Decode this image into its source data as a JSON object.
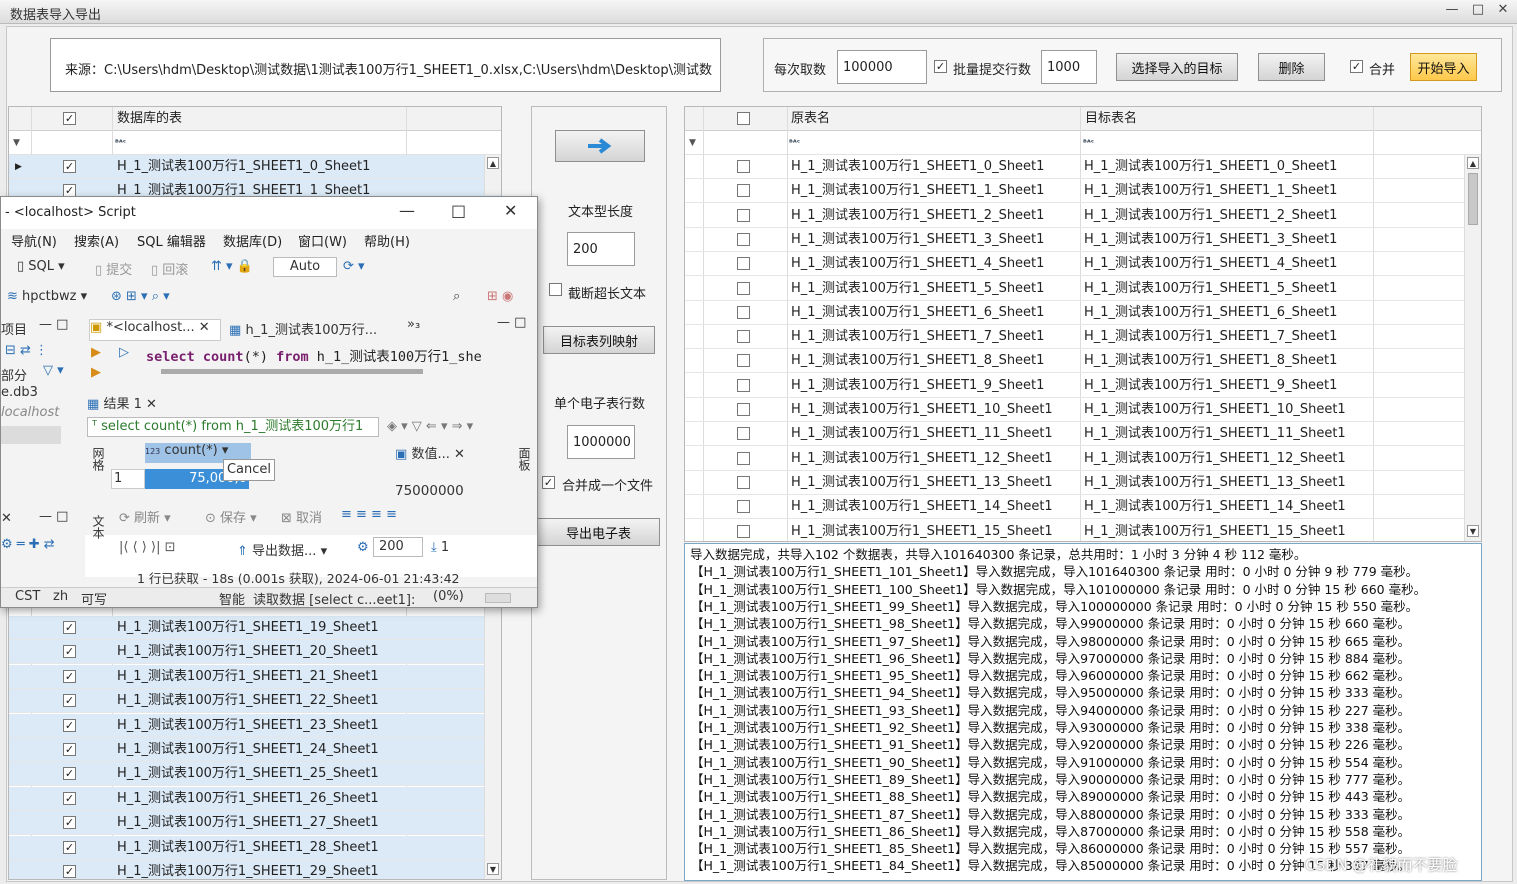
{
  "window": {
    "title": "数据表导入导出",
    "min": "—",
    "max": "□",
    "close": "✕"
  },
  "source": {
    "text": "来源：C:\\Users\\hdm\\Desktop\\测试数据\\1测试表100万行1_SHEET1_0.xlsx,C:\\Users\\hdm\\Desktop\\测试数"
  },
  "options": {
    "fetch_label": "每次取数",
    "fetch_value": "100000",
    "batch_label": "批量提交行数",
    "batch_value": "1000",
    "select_target": "选择导入的目标",
    "delete": "删除",
    "merge_label": "合并",
    "start": "开始导入"
  },
  "left_grid": {
    "header": "数据库的表",
    "filter_icon": "ᴮᴬᶜ",
    "rows_top": [
      "H_1_测试表100万行1_SHEET1_0_Sheet1",
      "H_1_测试表100万行1_SHEET1_1_Sheet1"
    ],
    "rows_bottom": [
      "H_1_测试表100万行1_SHEET1_19_Sheet1",
      "H_1_测试表100万行1_SHEET1_20_Sheet1",
      "H_1_测试表100万行1_SHEET1_21_Sheet1",
      "H_1_测试表100万行1_SHEET1_22_Sheet1",
      "H_1_测试表100万行1_SHEET1_23_Sheet1",
      "H_1_测试表100万行1_SHEET1_24_Sheet1",
      "H_1_测试表100万行1_SHEET1_25_Sheet1",
      "H_1_测试表100万行1_SHEET1_26_Sheet1",
      "H_1_测试表100万行1_SHEET1_27_Sheet1",
      "H_1_测试表100万行1_SHEET1_28_Sheet1",
      "H_1_测试表100万行1_SHEET1_29_Sheet1"
    ]
  },
  "mid": {
    "text_len_label": "文本型长度",
    "text_len_value": "200",
    "truncate_label": "截断超长文本",
    "map_button": "目标表列映射",
    "rows_label": "单个电子表行数",
    "rows_value": "1000000",
    "merge_file_label": "合并成一个文件",
    "export_button": "导出电子表"
  },
  "right_grid": {
    "col1": "原表名",
    "col2": "目标表名",
    "rows": [
      [
        "H_1_测试表100万行1_SHEET1_0_Sheet1",
        "H_1_测试表100万行1_SHEET1_0_Sheet1"
      ],
      [
        "H_1_测试表100万行1_SHEET1_1_Sheet1",
        "H_1_测试表100万行1_SHEET1_1_Sheet1"
      ],
      [
        "H_1_测试表100万行1_SHEET1_2_Sheet1",
        "H_1_测试表100万行1_SHEET1_2_Sheet1"
      ],
      [
        "H_1_测试表100万行1_SHEET1_3_Sheet1",
        "H_1_测试表100万行1_SHEET1_3_Sheet1"
      ],
      [
        "H_1_测试表100万行1_SHEET1_4_Sheet1",
        "H_1_测试表100万行1_SHEET1_4_Sheet1"
      ],
      [
        "H_1_测试表100万行1_SHEET1_5_Sheet1",
        "H_1_测试表100万行1_SHEET1_5_Sheet1"
      ],
      [
        "H_1_测试表100万行1_SHEET1_6_Sheet1",
        "H_1_测试表100万行1_SHEET1_6_Sheet1"
      ],
      [
        "H_1_测试表100万行1_SHEET1_7_Sheet1",
        "H_1_测试表100万行1_SHEET1_7_Sheet1"
      ],
      [
        "H_1_测试表100万行1_SHEET1_8_Sheet1",
        "H_1_测试表100万行1_SHEET1_8_Sheet1"
      ],
      [
        "H_1_测试表100万行1_SHEET1_9_Sheet1",
        "H_1_测试表100万行1_SHEET1_9_Sheet1"
      ],
      [
        "H_1_测试表100万行1_SHEET1_10_Sheet1",
        "H_1_测试表100万行1_SHEET1_10_Sheet1"
      ],
      [
        "H_1_测试表100万行1_SHEET1_11_Sheet1",
        "H_1_测试表100万行1_SHEET1_11_Sheet1"
      ],
      [
        "H_1_测试表100万行1_SHEET1_12_Sheet1",
        "H_1_测试表100万行1_SHEET1_12_Sheet1"
      ],
      [
        "H_1_测试表100万行1_SHEET1_13_Sheet1",
        "H_1_测试表100万行1_SHEET1_13_Sheet1"
      ],
      [
        "H_1_测试表100万行1_SHEET1_14_Sheet1",
        "H_1_测试表100万行1_SHEET1_14_Sheet1"
      ],
      [
        "H_1_测试表100万行1_SHEET1_15_Sheet1",
        "H_1_测试表100万行1_SHEET1_15_Sheet1"
      ]
    ]
  },
  "log": [
    "导入数据完成，共导入102 个数据表，共导入101640300 条记录，总共用时：1 小时 3 分钟 4 秒 112 毫秒。",
    "【H_1_测试表100万行1_SHEET1_101_Sheet1】导入数据完成，导入101640300 条记录 用时：0 小时 0 分钟 9 秒 779 毫秒。",
    "【H_1_测试表100万行1_SHEET1_100_Sheet1】导入数据完成，导入101000000 条记录 用时：0 小时 0 分钟 15 秒 660 毫秒。",
    "【H_1_测试表100万行1_SHEET1_99_Sheet1】导入数据完成，导入100000000 条记录 用时：0 小时 0 分钟 15 秒 550 毫秒。",
    "【H_1_测试表100万行1_SHEET1_98_Sheet1】导入数据完成，导入99000000 条记录 用时：0 小时 0 分钟 15 秒 660 毫秒。",
    "【H_1_测试表100万行1_SHEET1_97_Sheet1】导入数据完成，导入98000000 条记录 用时：0 小时 0 分钟 15 秒 665 毫秒。",
    "【H_1_测试表100万行1_SHEET1_96_Sheet1】导入数据完成，导入97000000 条记录 用时：0 小时 0 分钟 15 秒 884 毫秒。",
    "【H_1_测试表100万行1_SHEET1_95_Sheet1】导入数据完成，导入96000000 条记录 用时：0 小时 0 分钟 15 秒 662 毫秒。",
    "【H_1_测试表100万行1_SHEET1_94_Sheet1】导入数据完成，导入95000000 条记录 用时：0 小时 0 分钟 15 秒 333 毫秒。",
    "【H_1_测试表100万行1_SHEET1_93_Sheet1】导入数据完成，导入94000000 条记录 用时：0 小时 0 分钟 15 秒 227 毫秒。",
    "【H_1_测试表100万行1_SHEET1_92_Sheet1】导入数据完成，导入93000000 条记录 用时：0 小时 0 分钟 15 秒 338 毫秒。",
    "【H_1_测试表100万行1_SHEET1_91_Sheet1】导入数据完成，导入92000000 条记录 用时：0 小时 0 分钟 15 秒 226 毫秒。",
    "【H_1_测试表100万行1_SHEET1_90_Sheet1】导入数据完成，导入91000000 条记录 用时：0 小时 0 分钟 15 秒 554 毫秒。",
    "【H_1_测试表100万行1_SHEET1_89_Sheet1】导入数据完成，导入90000000 条记录 用时：0 小时 0 分钟 15 秒 777 毫秒。",
    "【H_1_测试表100万行1_SHEET1_88_Sheet1】导入数据完成，导入89000000 条记录 用时：0 小时 0 分钟 15 秒 443 毫秒。",
    "【H_1_测试表100万行1_SHEET1_87_Sheet1】导入数据完成，导入88000000 条记录 用时：0 小时 0 分钟 15 秒 333 毫秒。",
    "【H_1_测试表100万行1_SHEET1_86_Sheet1】导入数据完成，导入87000000 条记录 用时：0 小时 0 分钟 15 秒 558 毫秒。",
    "【H_1_测试表100万行1_SHEET1_85_Sheet1】导入数据完成，导入86000000 条记录 用时：0 小时 0 分钟 15 秒 557 毫秒。",
    "【H_1_测试表100万行1_SHEET1_84_Sheet1】导入数据完成，导入85000000 条记录 用时：0 小时 0 分钟 15 秒 337 毫秒。"
  ],
  "watermark": "CSDN @礼貌而不要脸",
  "dbeaver": {
    "title": "- <localhost> Script",
    "menu": [
      "导航(N)",
      "搜索(A)",
      "SQL 编辑器",
      "数据库(D)",
      "窗口(W)",
      "帮助(H)"
    ],
    "tb_sql": "SQL",
    "tb_commit": "提交",
    "tb_rollback": "回滚",
    "tb_auto": "Auto",
    "db": "hpctbwz",
    "left_tab": "项目",
    "left_db": "e.db3",
    "left_part": "部分",
    "left_local": "localhost",
    "tab1": "*<localhost...",
    "tab2": "h_1_测试表100万行...",
    "tab_more": "»₃",
    "sql": "h_1_测试表100万行1_she",
    "result_tab": "结果 1",
    "result_filter": "select count(*) from h_1_测试表100万行1",
    "col": "count(*)",
    "row_no": "1",
    "row_val": "75,000,0",
    "cancel": "Cancel",
    "value_panel": "数值...",
    "value": "75000000",
    "refresh": "刷新",
    "save": "保存",
    "cancel_btn": "取消",
    "export": "导出数据...",
    "limit": "200",
    "fetched": "1",
    "status": "1 行已获取 - 18s (0.001s 获取), 2024-06-01 21:43:42",
    "cst": "CST",
    "zh": "zh",
    "writable": "可写",
    "smart": "智能",
    "reading": "读取数据 [select c...eet1]:",
    "pct": "(0%)",
    "side_grid": "网格",
    "side_text": "文本",
    "side_panel": "面板"
  }
}
